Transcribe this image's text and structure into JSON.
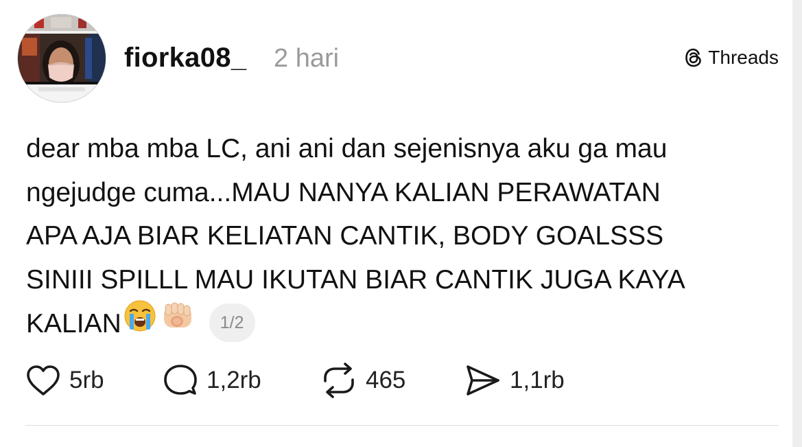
{
  "post": {
    "username": "fiorka08_",
    "timestamp": "2 hari",
    "brand_label": "Threads",
    "text_lines": [
      "dear mba mba LC, ani ani dan sejenisnya aku ga mau",
      "ngejudge cuma...MAU NANYA KALIAN PERAWATAN",
      "APA AJA BIAR KELIATAN CANTIK, BODY GOALSSS",
      "SINIII SPILLL MAU IKUTAN BIAR CANTIK JUGA KAYA",
      "KALIAN"
    ],
    "pager": "1/2"
  },
  "actions": {
    "likes": "5rb",
    "replies": "1,2rb",
    "reposts": "465",
    "shares": "1,1rb"
  },
  "icons": {
    "avatar": "profile-photo-masked-woman",
    "brand": "threads-logo-icon",
    "emoji_1": "loudly-crying-face-emoji",
    "emoji_2": "backhand-index-pointing-at-viewer-emoji",
    "like": "heart-icon",
    "reply": "comment-bubble-icon",
    "repost": "repost-arrows-icon",
    "share": "send-paper-plane-icon"
  },
  "colors": {
    "text": "#111111",
    "muted": "#9a9a9a",
    "pager_bg": "#efefef",
    "divider": "#dcdcdc",
    "background": "#ffffff"
  }
}
